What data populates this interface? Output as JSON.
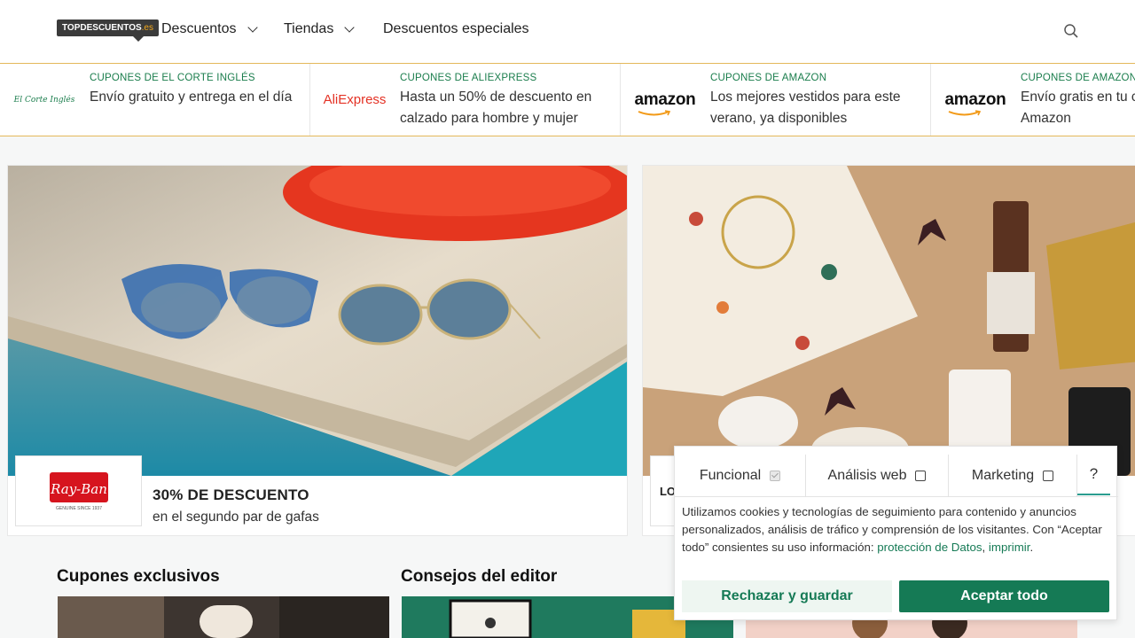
{
  "header": {
    "logo_main": "TOPDESCUENTOS",
    "logo_tld": ".es",
    "nav": [
      {
        "label": "Descuentos"
      },
      {
        "label": "Tiendas"
      },
      {
        "label": "Descuentos especiales"
      }
    ],
    "search_icon": "search-icon"
  },
  "promos": [
    {
      "logo": "El Corte Inglés",
      "category": "CUPONES DE EL CORTE INGLÉS",
      "text": "Envío gratuito y entrega en el día"
    },
    {
      "logo": "AliExpress",
      "category": "CUPONES DE ALIEXPRESS",
      "text": "Hasta un 50% de descuento en calzado para hombre y mujer"
    },
    {
      "logo": "amazon",
      "category": "CUPONES DE AMAZON",
      "text": "Los mejores vestidos para este verano, ya disponibles"
    },
    {
      "logo": "amazon",
      "category": "CUPONES DE AMAZON",
      "text": "Envío gratis en tu compra de Amazon"
    }
  ],
  "hero": [
    {
      "brand": "Ray-Ban",
      "brand_tagline": "GENUINE SINCE 1937",
      "title": "30% DE DESCUENTO",
      "subtitle": "en el segundo par de gafas"
    },
    {
      "brand_partial": "LO"
    }
  ],
  "sections": [
    {
      "title": "Cupones exclusivos"
    },
    {
      "title": "Consejos del editor"
    }
  ],
  "cookie": {
    "tabs": [
      {
        "label": "Funcional",
        "checked": true
      },
      {
        "label": "Análisis web",
        "checked": false
      },
      {
        "label": "Marketing",
        "checked": false
      }
    ],
    "help": "?",
    "text_before": "Utilizamos cookies y tecnologías de seguimiento para contenido y anuncios personalizados, análisis de tráfico y comprensión de los visitantes. Con “Aceptar todo” consientes su uso información: ",
    "link_privacy": "protección de Datos",
    "separator": ", ",
    "link_imprint": "imprimir",
    "period": ".",
    "reject_label": "Rechazar y guardar",
    "accept_label": "Aceptar todo"
  },
  "colors": {
    "accent_green": "#157a55",
    "header_border": "#e4b85a",
    "logo_orange": "#f2a71b"
  }
}
